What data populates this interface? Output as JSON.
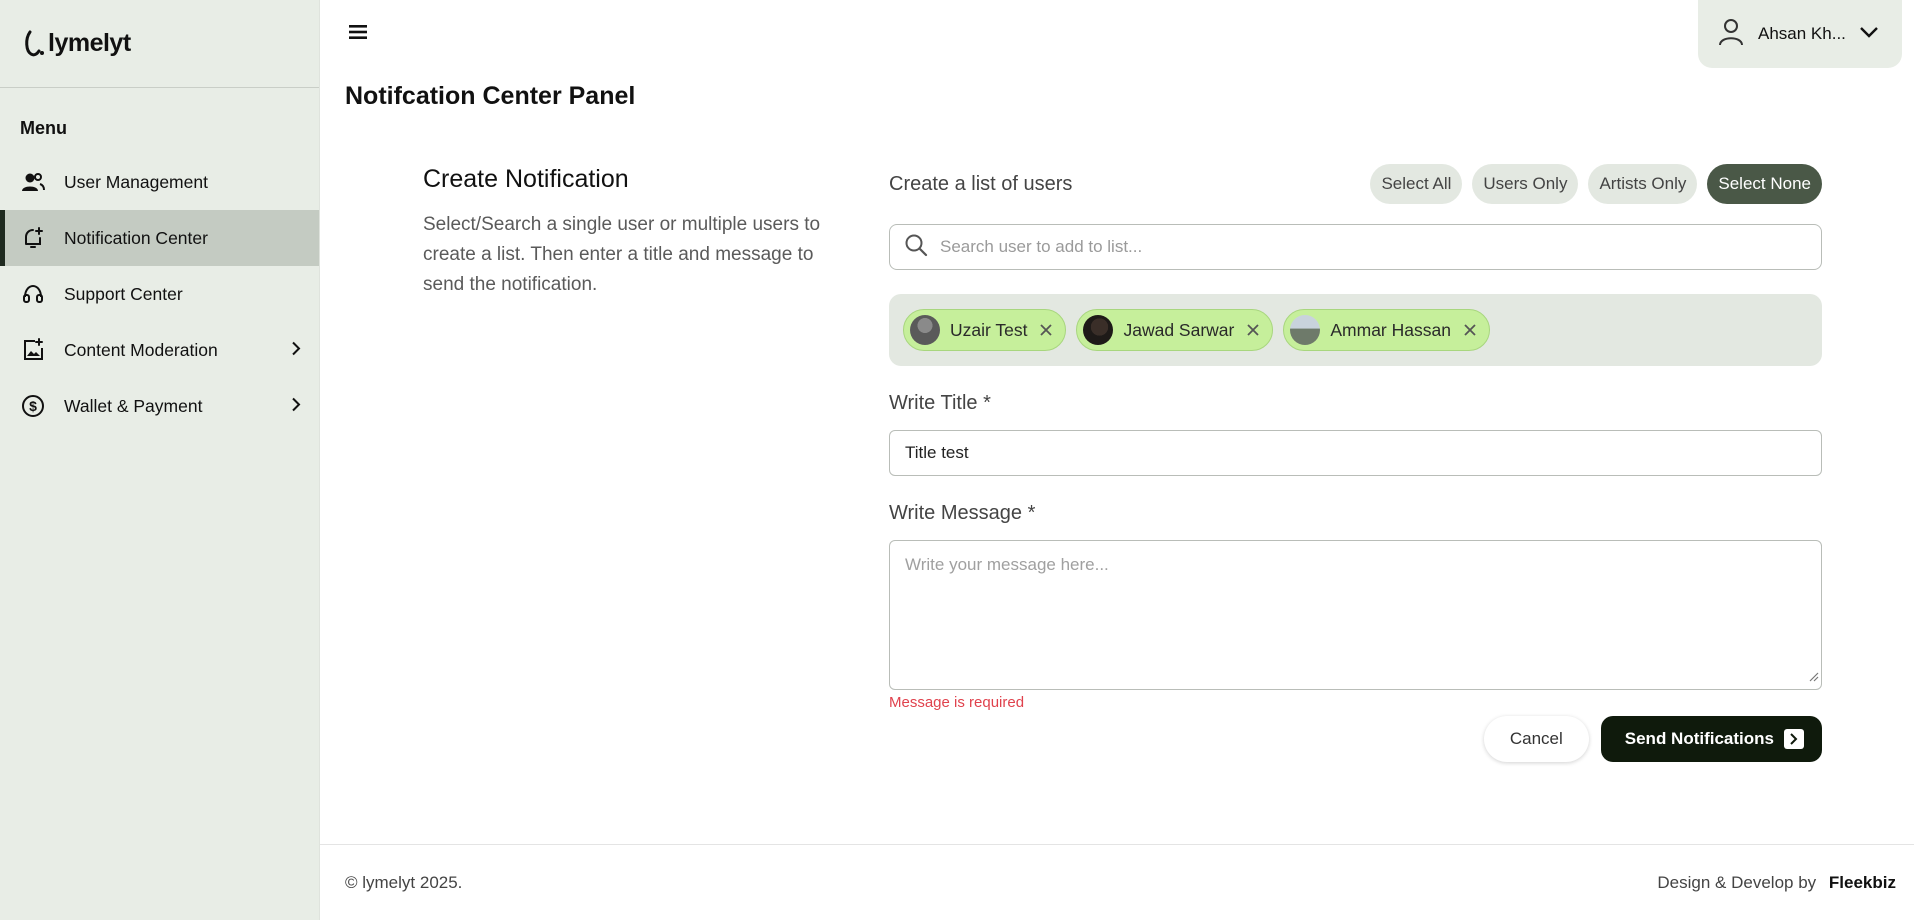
{
  "app": {
    "logo_text": "lymelyt"
  },
  "sidebar": {
    "menu_label": "Menu",
    "items": [
      {
        "label": "User Management",
        "icon": "users-icon",
        "active": false,
        "has_submenu": false
      },
      {
        "label": "Notification Center",
        "icon": "bell-plus-icon",
        "active": true,
        "has_submenu": false
      },
      {
        "label": "Support Center",
        "icon": "headset-icon",
        "active": false,
        "has_submenu": false
      },
      {
        "label": "Content Moderation",
        "icon": "image-plus-icon",
        "active": false,
        "has_submenu": true
      },
      {
        "label": "Wallet & Payment",
        "icon": "dollar-circle-icon",
        "active": false,
        "has_submenu": true
      }
    ]
  },
  "header": {
    "user_name": "Ahsan Kh..."
  },
  "page": {
    "title": "Notifcation Center Panel"
  },
  "intro": {
    "heading": "Create Notification",
    "description": "Select/Search a single user or multiple users to create a list. Then enter a title and message to send the notification."
  },
  "form": {
    "list_label": "Create a list of users",
    "filters": [
      "Select All",
      "Users Only",
      "Artists Only",
      "Select None"
    ],
    "active_filter": "Select None",
    "search_placeholder": "Search user to add to list...",
    "selected_users": [
      "Uzair Test",
      "Jawad Sarwar",
      "Ammar Hassan"
    ],
    "title_label": "Write Title *",
    "title_value": "Title test",
    "message_label": "Write Message *",
    "message_placeholder": "Write your message here...",
    "message_error": "Message is required",
    "cancel_label": "Cancel",
    "send_label": "Send Notifications"
  },
  "footer": {
    "copyright": "© lymelyt 2025.",
    "credit_prefix": "Design & Develop by",
    "credit_brand": "Fleekbiz"
  },
  "colors": {
    "sidebar_bg": "#e8ede6",
    "active_item_bg": "#c4cbc2",
    "chip_bg": "#c6ef9b",
    "primary_button": "#0f1a0c",
    "error": "#e0424d"
  }
}
